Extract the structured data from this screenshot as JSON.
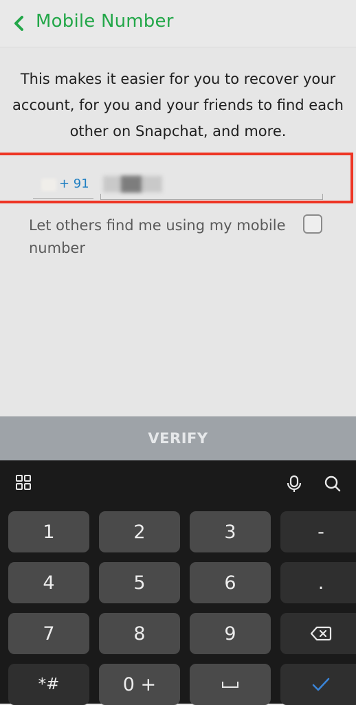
{
  "header": {
    "title": "Mobile Number"
  },
  "description": "This makes it easier for you to recover your account, for you and your friends to find each other on Snapchat, and more.",
  "phone": {
    "country_code": "+ 91"
  },
  "share_option": {
    "label": "Let others find me using my mobile number",
    "checked": false
  },
  "verify_button": {
    "label": "VERIFY"
  },
  "keyboard": {
    "keys": [
      {
        "label": "1"
      },
      {
        "label": "2"
      },
      {
        "label": "3"
      },
      {
        "label": "-"
      },
      {
        "label": "4"
      },
      {
        "label": "5"
      },
      {
        "label": "6"
      },
      {
        "label": "."
      },
      {
        "label": "7"
      },
      {
        "label": "8"
      },
      {
        "label": "9"
      },
      {
        "label": ""
      },
      {
        "label": "*#"
      },
      {
        "label": "0 +"
      },
      {
        "label": ""
      },
      {
        "label": ""
      }
    ],
    "icons": [
      "apps-grid-icon",
      "microphone-icon",
      "search-icon",
      "backspace-icon",
      "space-icon",
      "done-check-icon"
    ],
    "accent_color": "#3a84d6"
  },
  "colors": {
    "title_green": "#23a749",
    "highlight_red": "#ee3524",
    "link_blue": "#1f7fc2"
  }
}
